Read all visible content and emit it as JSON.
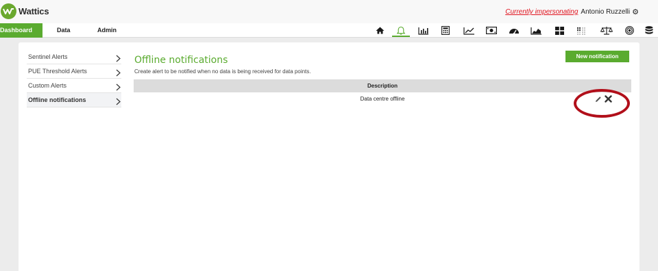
{
  "brand": {
    "name": "Wattics",
    "color": "#5aab2f"
  },
  "header": {
    "impersonating_label": "Currently impersonating",
    "user_name": "Antonio Ruzzelli",
    "settings_icon": "cogs-icon"
  },
  "nav": {
    "tabs": [
      {
        "label": "Dashboard",
        "active": true
      },
      {
        "label": "Data",
        "active": false
      },
      {
        "label": "Admin",
        "active": false
      }
    ],
    "icons": [
      "home-icon",
      "bell-icon",
      "bar-chart-icon",
      "calculator-icon",
      "line-chart-icon",
      "money-icon",
      "gauge-icon",
      "area-chart-icon",
      "grid-icon",
      "dots-grid-icon",
      "balance-scale-icon",
      "target-icon",
      "database-icon"
    ],
    "active_icon": "bell-icon"
  },
  "sidebar": {
    "items": [
      {
        "label": "Sentinel Alerts",
        "active": false
      },
      {
        "label": "PUE Threshold Alerts",
        "active": false
      },
      {
        "label": "Custom Alerts",
        "active": false
      },
      {
        "label": "Offline notifications",
        "active": true
      }
    ]
  },
  "main": {
    "title": "Offline notifications",
    "subtitle": "Create alert to be notified when no data is being received for data points.",
    "new_button": "New notification",
    "table": {
      "columns": [
        "Description"
      ],
      "rows": [
        {
          "description": "Data centre offline",
          "actions": [
            "edit-icon",
            "delete-icon"
          ]
        }
      ]
    }
  },
  "colors": {
    "accent": "#5aab2f",
    "highlight": "#b10f1a",
    "impersonate": "#e0121d"
  }
}
